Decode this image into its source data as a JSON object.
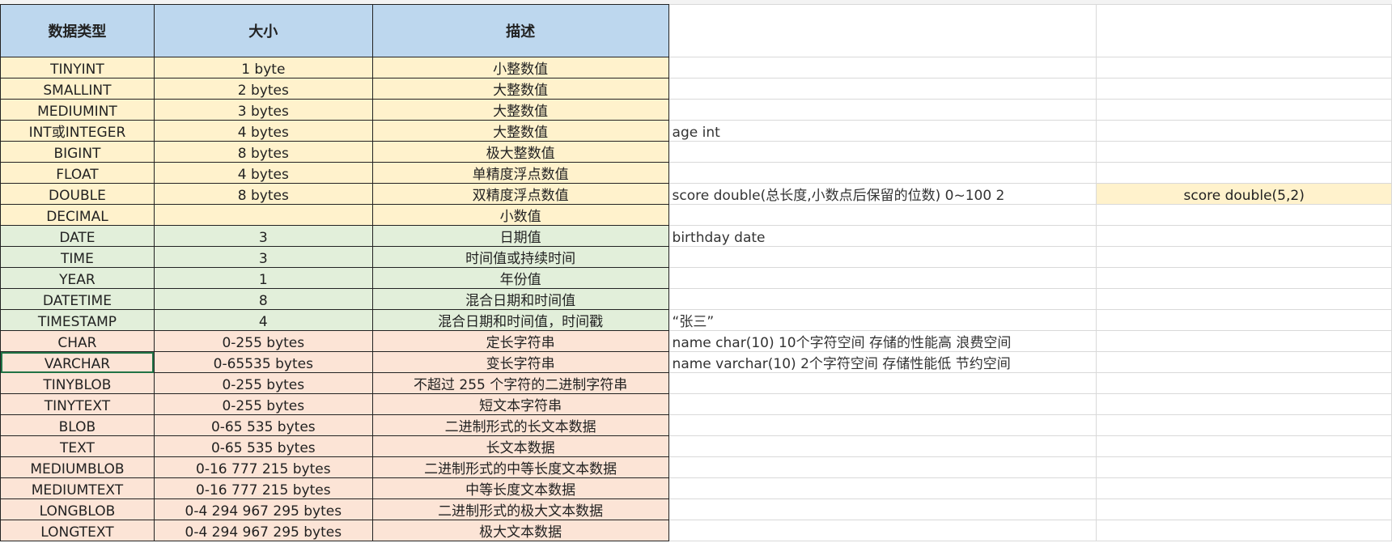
{
  "headers": [
    "数据类型",
    "大小",
    "描述"
  ],
  "rows": [
    {
      "type": "TINYINT",
      "size": "1 byte",
      "desc": "小整数值",
      "group": "num",
      "note": ""
    },
    {
      "type": "SMALLINT",
      "size": "2 bytes",
      "desc": "大整数值",
      "group": "num",
      "note": ""
    },
    {
      "type": "MEDIUMINT",
      "size": "3 bytes",
      "desc": "大整数值",
      "group": "num",
      "note": ""
    },
    {
      "type": "INT或INTEGER",
      "size": "4 bytes",
      "desc": "大整数值",
      "group": "num",
      "note": "age int"
    },
    {
      "type": "BIGINT",
      "size": "8 bytes",
      "desc": "极大整数值",
      "group": "num",
      "note": ""
    },
    {
      "type": "FLOAT",
      "size": "4 bytes",
      "desc": "单精度浮点数值",
      "group": "num",
      "note": ""
    },
    {
      "type": "DOUBLE",
      "size": "8 bytes",
      "desc": "双精度浮点数值",
      "group": "num",
      "note": "score double(总长度,小数点后保留的位数)  0~100 2",
      "extra": "score double(5,2)"
    },
    {
      "type": "DECIMAL",
      "size": "",
      "desc": "小数值",
      "group": "num",
      "note": ""
    },
    {
      "type": "DATE",
      "size": "3",
      "desc": "日期值",
      "group": "dt",
      "note": "birthday date"
    },
    {
      "type": "TIME",
      "size": "3",
      "desc": "时间值或持续时间",
      "group": "dt",
      "note": ""
    },
    {
      "type": "YEAR",
      "size": "1",
      "desc": "年份值",
      "group": "dt",
      "note": ""
    },
    {
      "type": "DATETIME",
      "size": "8",
      "desc": "混合日期和时间值",
      "group": "dt",
      "note": ""
    },
    {
      "type": "TIMESTAMP",
      "size": "4",
      "desc": "混合日期和时间值，时间戳",
      "group": "dt",
      "note": "“张三”"
    },
    {
      "type": "CHAR",
      "size": "0-255 bytes",
      "desc": "定长字符串",
      "group": "str",
      "note": "name char(10)    10个字符空间     存储的性能高  浪费空间"
    },
    {
      "type": "VARCHAR",
      "size": "0-65535 bytes",
      "desc": "变长字符串",
      "group": "str",
      "note": "name varchar(10)   2个字符空间      存储性能低  节约空间"
    },
    {
      "type": "TINYBLOB",
      "size": "0-255 bytes",
      "desc": "不超过 255 个字符的二进制字符串",
      "group": "str",
      "note": ""
    },
    {
      "type": "TINYTEXT",
      "size": "0-255 bytes",
      "desc": "短文本字符串",
      "group": "str",
      "note": ""
    },
    {
      "type": "BLOB",
      "size": "0-65 535 bytes",
      "desc": "二进制形式的长文本数据",
      "group": "str",
      "note": ""
    },
    {
      "type": "TEXT",
      "size": "0-65 535 bytes",
      "desc": "长文本数据",
      "group": "str",
      "note": ""
    },
    {
      "type": "MEDIUMBLOB",
      "size": "0-16 777 215 bytes",
      "desc": "二进制形式的中等长度文本数据",
      "group": "str",
      "note": ""
    },
    {
      "type": "MEDIUMTEXT",
      "size": "0-16 777 215 bytes",
      "desc": "中等长度文本数据",
      "group": "str",
      "note": ""
    },
    {
      "type": "LONGBLOB",
      "size": "0-4 294 967 295 bytes",
      "desc": "二进制形式的极大文本数据",
      "group": "str",
      "note": ""
    },
    {
      "type": "LONGTEXT",
      "size": "0-4 294 967 295 bytes",
      "desc": "极大文本数据",
      "group": "str",
      "note": ""
    }
  ],
  "colors": {
    "header": "#bdd7ee",
    "numeric": "#fff2cc",
    "datetime": "#e2efda",
    "string": "#fce4d6"
  }
}
